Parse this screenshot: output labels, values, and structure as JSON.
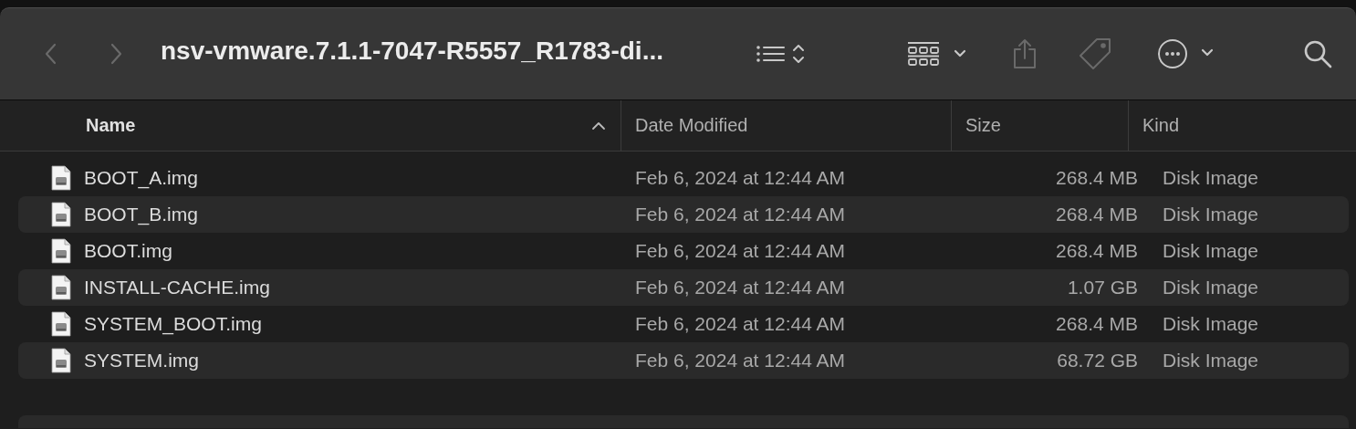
{
  "window": {
    "title": "nsv-vmware.7.1.1-7047-R5557_R1783-di..."
  },
  "toolbar": [
    {
      "kind": "back",
      "disabled": true
    },
    {
      "kind": "forward",
      "disabled": true
    },
    {
      "kind": "list-view",
      "disabled": false
    },
    {
      "kind": "group",
      "disabled": false
    },
    {
      "kind": "share",
      "disabled": true
    },
    {
      "kind": "tag",
      "disabled": true
    },
    {
      "kind": "more",
      "disabled": false
    },
    {
      "kind": "search",
      "disabled": false
    }
  ],
  "table": {
    "columns": [
      {
        "label": "Name",
        "sorted": true
      },
      {
        "label": "Date Modified",
        "sorted": false
      },
      {
        "label": "Size",
        "sorted": false
      },
      {
        "label": "Kind",
        "sorted": false
      }
    ],
    "rows": [
      {
        "name": "BOOT_A.img",
        "date": "Feb 6, 2024 at 12:44 AM",
        "size": "268.4 MB",
        "kind": "Disk Image"
      },
      {
        "name": "BOOT_B.img",
        "date": "Feb 6, 2024 at 12:44 AM",
        "size": "268.4 MB",
        "kind": "Disk Image"
      },
      {
        "name": "BOOT.img",
        "date": "Feb 6, 2024 at 12:44 AM",
        "size": "268.4 MB",
        "kind": "Disk Image"
      },
      {
        "name": "INSTALL-CACHE.img",
        "date": "Feb 6, 2024 at 12:44 AM",
        "size": "1.07 GB",
        "kind": "Disk Image"
      },
      {
        "name": "SYSTEM_BOOT.img",
        "date": "Feb 6, 2024 at 12:44 AM",
        "size": "268.4 MB",
        "kind": "Disk Image"
      },
      {
        "name": "SYSTEM.img",
        "date": "Feb 6, 2024 at 12:44 AM",
        "size": "68.72 GB",
        "kind": "Disk Image"
      }
    ]
  }
}
